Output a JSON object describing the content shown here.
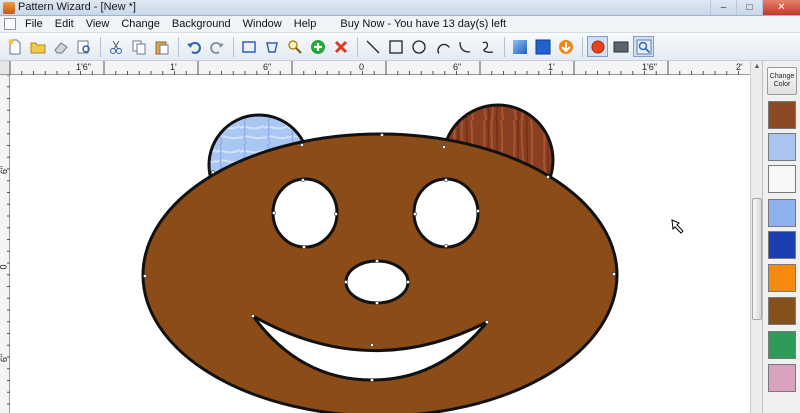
{
  "window": {
    "title": "Pattern Wizard - [New *]",
    "controls": {
      "minimize": "–",
      "maximize": "□",
      "close": "✕"
    }
  },
  "menu": {
    "items": [
      "File",
      "Edit",
      "View",
      "Change",
      "Background",
      "Window",
      "Help"
    ],
    "buy_now": "Buy Now - You have 13 day(s) left"
  },
  "toolbar": {
    "icons": [
      "new-file-icon",
      "open-folder-icon",
      "eraser-icon",
      "print-preview-icon",
      "cut-icon",
      "copy-icon",
      "paste-icon",
      "undo-icon",
      "redo-icon",
      "select-rectangle-icon",
      "lasso-icon",
      "zoom-icon",
      "add-icon",
      "delete-icon",
      "line-tool-icon",
      "rectangle-tool-icon",
      "circle-tool-icon",
      "arc-tool-icon",
      "curve-tool-icon",
      "freehand-tool-icon",
      "fill-gradient-icon",
      "solid-fill-icon",
      "arrow-down-circle-icon",
      "record-icon",
      "background-icon",
      "zoom-fit-icon"
    ]
  },
  "ruler": {
    "h_labels": [
      "1'6\"",
      "1'",
      "6\"",
      "0",
      "6\"",
      "1'",
      "1'6\"",
      "2'"
    ],
    "v_labels": [
      "6\"",
      "0",
      "6\""
    ]
  },
  "palette": {
    "change_color_label": "Change Color",
    "swatches": [
      {
        "name": "wood-brown",
        "color": "#8b4a24"
      },
      {
        "name": "light-blue-glass",
        "color": "#a9c4ee"
      },
      {
        "name": "white",
        "color": "#f7f7f7"
      },
      {
        "name": "periwinkle-glass",
        "color": "#8fb0ee"
      },
      {
        "name": "deep-blue",
        "color": "#1b3fae"
      },
      {
        "name": "orange",
        "color": "#f58a0f"
      },
      {
        "name": "brown",
        "color": "#86501b"
      },
      {
        "name": "green-glass",
        "color": "#2f9a5a"
      },
      {
        "name": "pink-glass",
        "color": "#d9a3bf"
      }
    ]
  },
  "drawing": {
    "face_color": "#8b4c17",
    "left_ear_color": "#aac6f3",
    "right_ear_color": "#8a3f22",
    "hole_color": "#ffffff",
    "outline_color": "#111111"
  }
}
